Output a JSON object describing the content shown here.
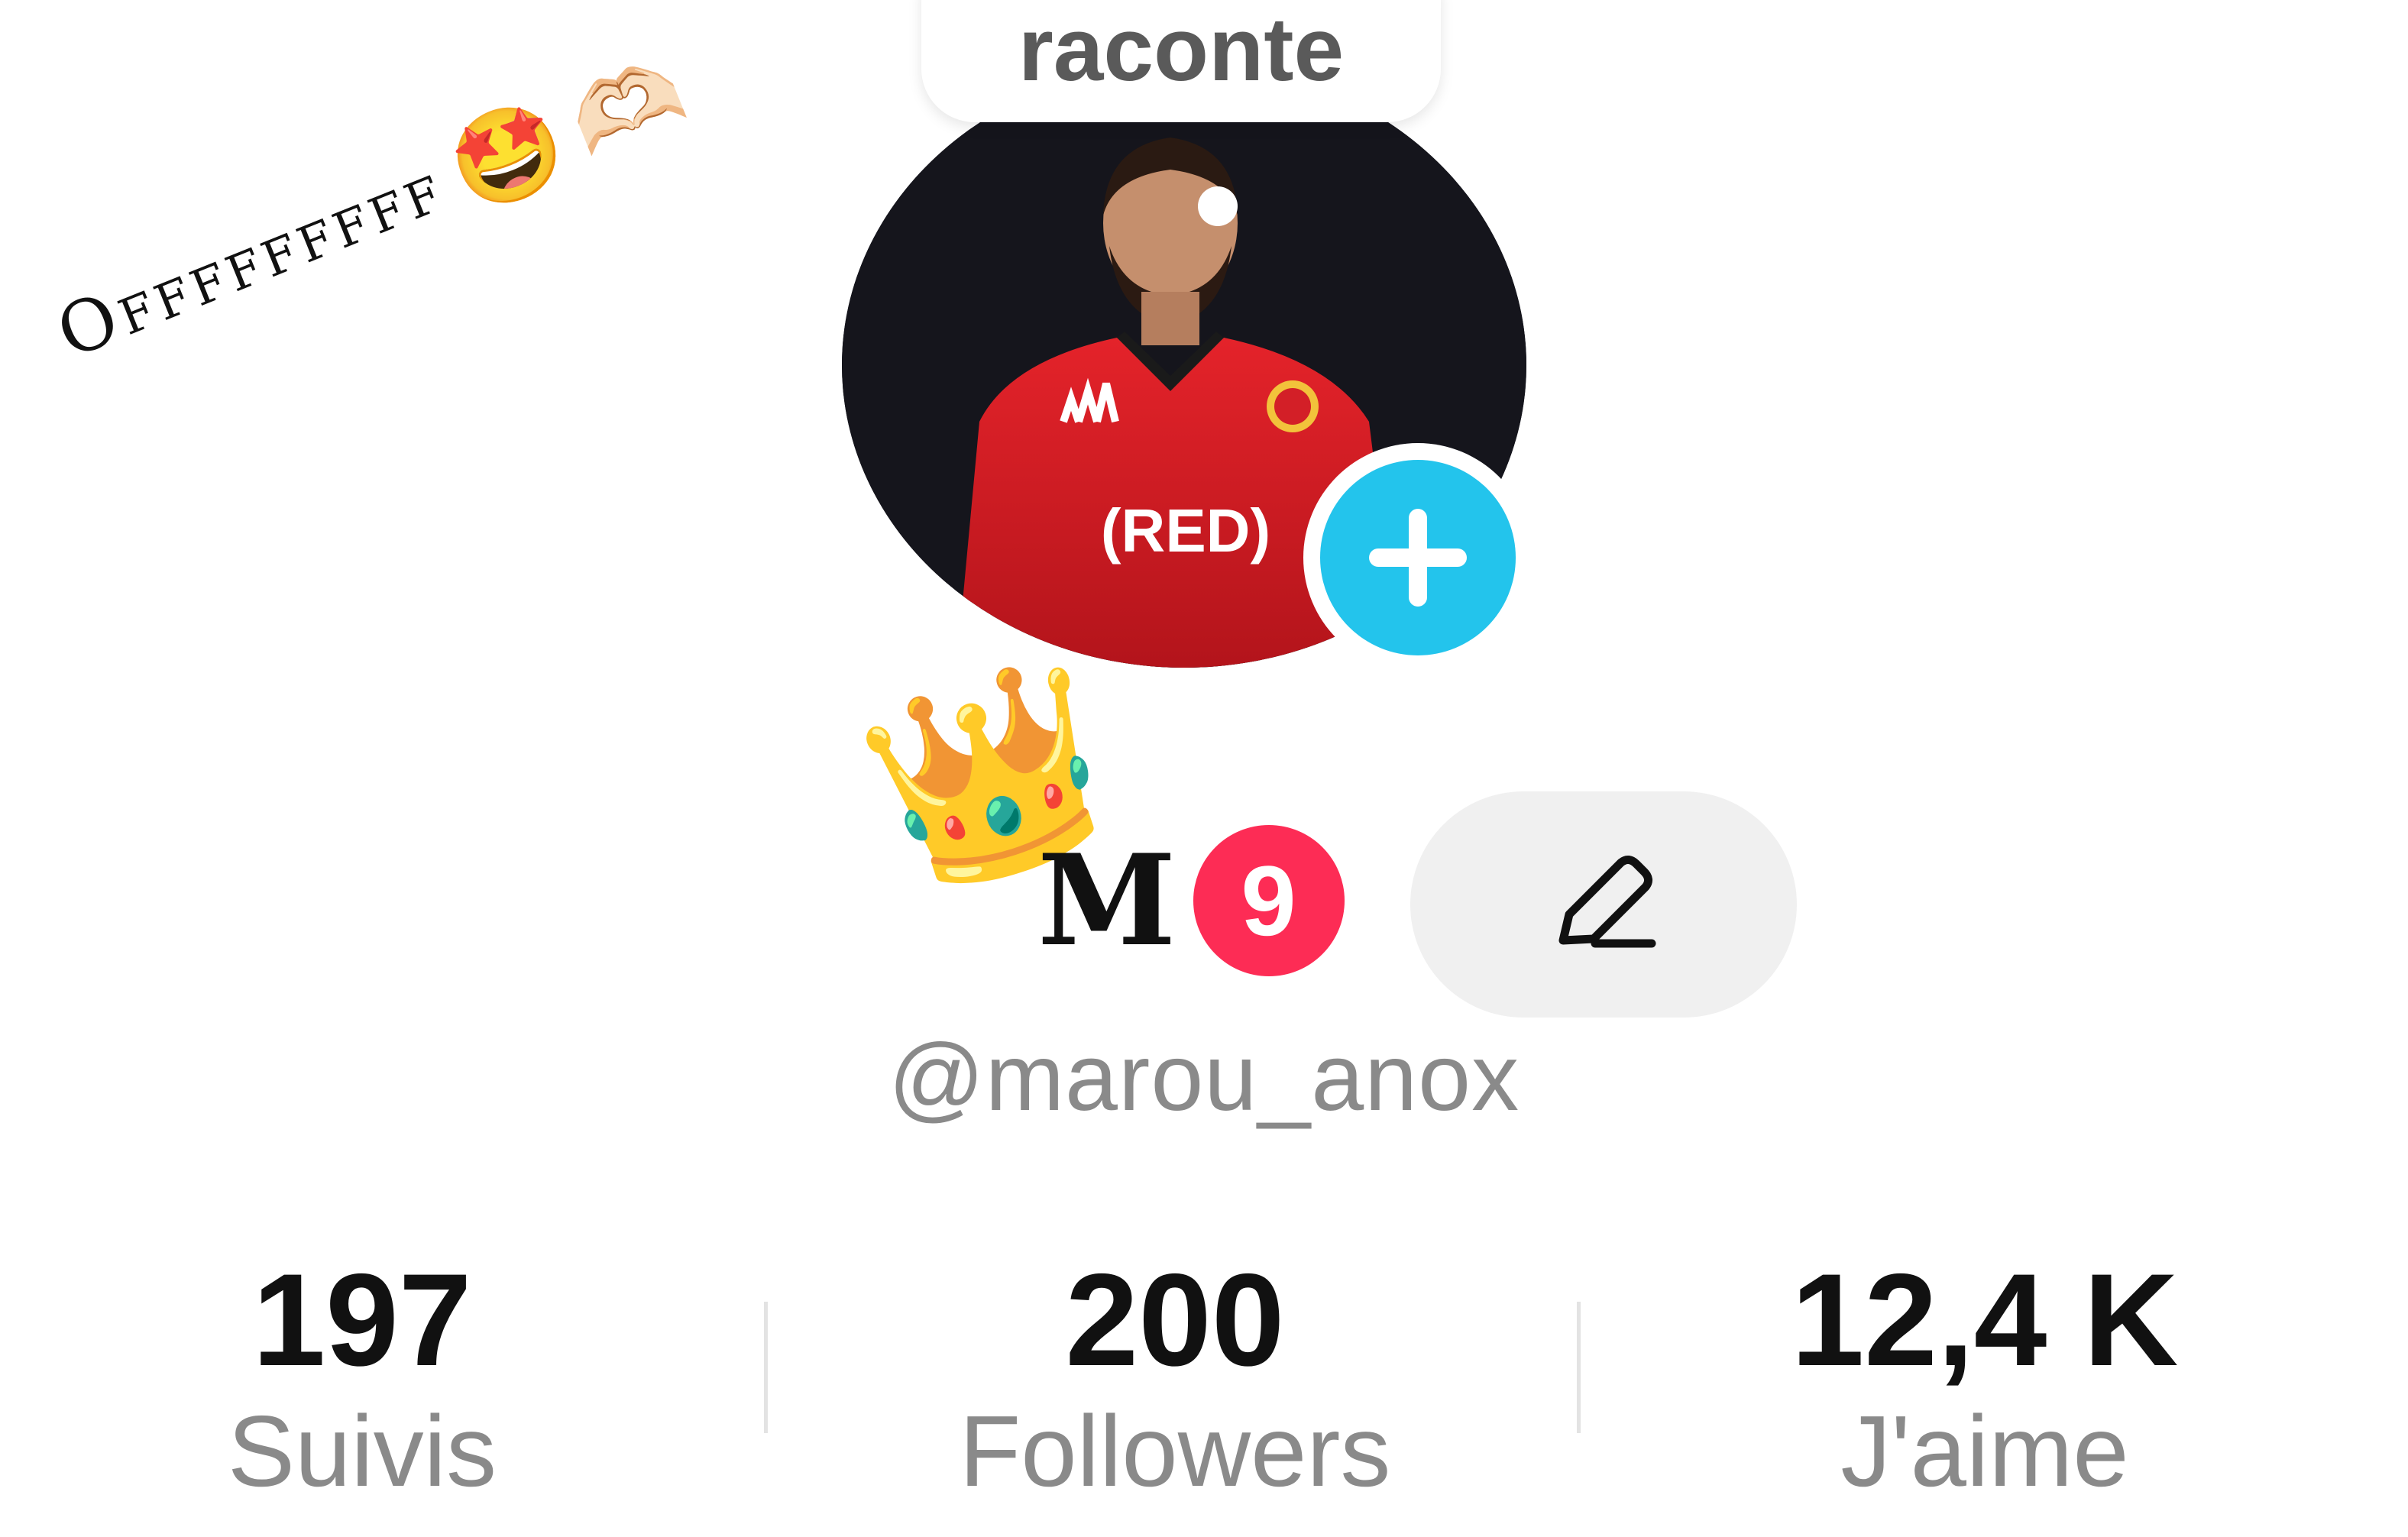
{
  "overlay": {
    "caption": "Offfffffff",
    "emojis": [
      "🤩",
      "🫶🏻"
    ]
  },
  "bubble": {
    "text": "raconte"
  },
  "avatar": {
    "shirt_text": "(RED)",
    "add_button_icon": "plus-icon",
    "add_button_color": "#23c4ec"
  },
  "profile": {
    "crown_emoji": "👑",
    "name_initial": "M",
    "name_badge": "9",
    "badge_color": "#fd2c55",
    "edit_icon": "pencil-icon",
    "handle": "@marou_anox"
  },
  "stats": [
    {
      "value": "197",
      "label": "Suivis"
    },
    {
      "value": "200",
      "label": "Followers"
    },
    {
      "value": "12,4 K",
      "label": "J'aime"
    }
  ]
}
